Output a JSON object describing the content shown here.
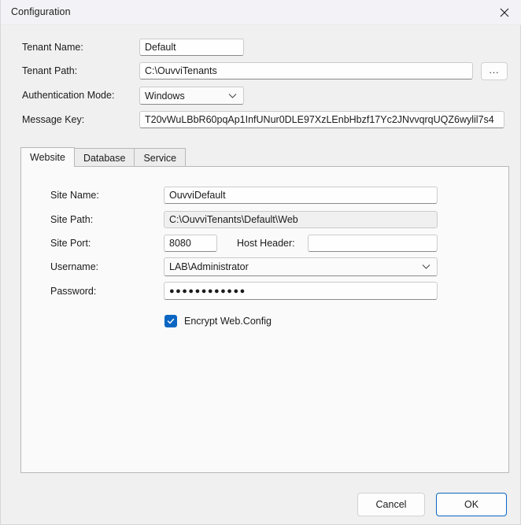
{
  "window": {
    "title": "Configuration",
    "close_icon": "close-icon"
  },
  "form": {
    "tenant_name": {
      "label": "Tenant Name:",
      "value": "Default"
    },
    "tenant_path": {
      "label": "Tenant Path:",
      "value": "C:\\OuvviTenants",
      "browse_label": "..."
    },
    "auth_mode": {
      "label": "Authentication Mode:",
      "value": "Windows",
      "options": [
        "Windows"
      ]
    },
    "message_key": {
      "label": "Message Key:",
      "value": "T20vWuLBbR60pqAp1InfUNur0DLE97XzLEnbHbzf17Yc2JNvvqrqUQZ6wylil7s4"
    }
  },
  "tabs": [
    {
      "label": "Website",
      "active": true
    },
    {
      "label": "Database",
      "active": false
    },
    {
      "label": "Service",
      "active": false
    }
  ],
  "website_tab": {
    "site_name": {
      "label": "Site Name:",
      "value": "OuvviDefault"
    },
    "site_path": {
      "label": "Site Path:",
      "value": "C:\\OuvviTenants\\Default\\Web"
    },
    "site_port": {
      "label": "Site Port:",
      "value": "8080"
    },
    "host_header": {
      "label": "Host Header:",
      "value": ""
    },
    "username": {
      "label": "Username:",
      "value": "LAB\\Administrator",
      "options": [
        "LAB\\Administrator"
      ]
    },
    "password": {
      "label": "Password:",
      "value": "●●●●●●●●●●●●"
    },
    "encrypt": {
      "label": "Encrypt Web.Config",
      "checked": true
    }
  },
  "footer": {
    "cancel_label": "Cancel",
    "ok_label": "OK"
  },
  "colors": {
    "accent": "#0a66c2",
    "window_bg": "#f0f0f0",
    "titlebar_bg": "#f3f3f7",
    "panel_bg": "#fafafa"
  }
}
